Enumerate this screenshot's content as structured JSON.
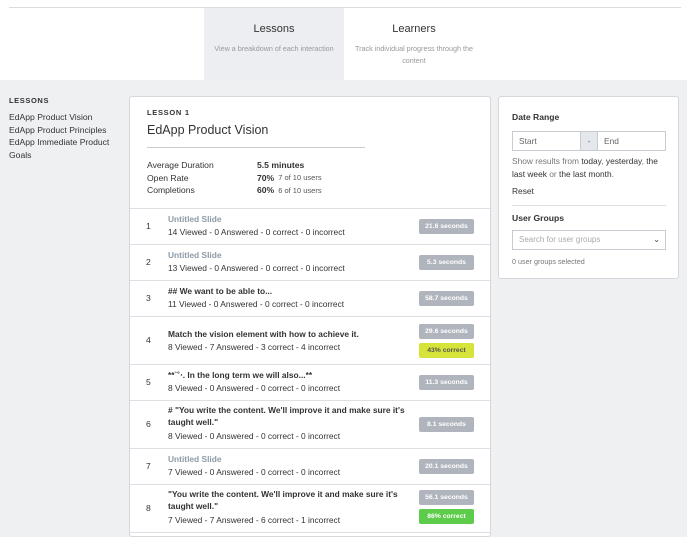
{
  "tabs": [
    {
      "title": "Lessons",
      "desc": "View a breakdown of each interaction"
    },
    {
      "title": "Learners",
      "desc": "Track individual progress through the content"
    }
  ],
  "sidebar": {
    "heading": "LESSONS",
    "items": [
      "EdApp Product Vision",
      "EdApp Product Principles",
      "EdApp Immediate Product Goals"
    ]
  },
  "lesson": {
    "label": "LESSON 1",
    "title": "EdApp Product Vision",
    "stats": [
      {
        "key": "Average Duration",
        "value": "5.5 minutes",
        "sub": ""
      },
      {
        "key": "Open Rate",
        "value": "70%",
        "sub": "7 of 10 users"
      },
      {
        "key": "Completions",
        "value": "60%",
        "sub": "6 of 10 users"
      }
    ]
  },
  "slides": [
    {
      "num": "1",
      "title": "Untitled Slide",
      "untitled": true,
      "info": "14 Viewed - 0 Answered - 0 correct - 0 incorrect",
      "time": "21.6 seconds",
      "correct": ""
    },
    {
      "num": "2",
      "title": "Untitled Slide",
      "untitled": true,
      "info": "13 Viewed - 0 Answered - 0 correct - 0 incorrect",
      "time": "5.3 seconds",
      "correct": ""
    },
    {
      "num": "3",
      "title": "## We want to be able to...",
      "untitled": false,
      "info": "11 Viewed - 0 Answered - 0 correct - 0 incorrect",
      "time": "58.7 seconds",
      "correct": ""
    },
    {
      "num": "4",
      "title": "Match the vision element with how to achieve it.",
      "untitled": false,
      "info": "8 Viewed - 7 Answered - 3 correct - 4 incorrect",
      "time": "29.6 seconds",
      "correct": "43% correct",
      "correctColor": "lime"
    },
    {
      "num": "5",
      "title": "**`˚‧. In the long term we will also...**",
      "untitled": false,
      "info": "8 Viewed - 0 Answered - 0 correct - 0 incorrect",
      "time": "11.3 seconds",
      "correct": ""
    },
    {
      "num": "6",
      "title": "# \"You write the content. We'll improve it and make sure it's taught well.\"",
      "untitled": false,
      "info": "8 Viewed - 0 Answered - 0 correct - 0 incorrect",
      "time": "8.1 seconds",
      "correct": ""
    },
    {
      "num": "7",
      "title": "Untitled Slide",
      "untitled": true,
      "info": "7 Viewed - 0 Answered - 0 correct - 0 incorrect",
      "time": "20.1 seconds",
      "correct": ""
    },
    {
      "num": "8",
      "title": "\"You write the content. We'll improve it and make sure it's taught well.\"",
      "untitled": false,
      "info": "7 Viewed - 7 Answered - 6 correct - 1 incorrect",
      "time": "56.1 seconds",
      "correct": "86% correct",
      "correctColor": "green"
    }
  ],
  "filters": {
    "date_title": "Date Range",
    "start_placeholder": "Start",
    "dash": "-",
    "end_placeholder": "End",
    "show_prefix": "Show results from ",
    "opt_today": "today",
    "comma": ", ",
    "opt_yesterday": "yesterday",
    "comma2": ", ",
    "opt_week": "the last week",
    "or": " or ",
    "opt_month": "the last month",
    "period": ".",
    "reset": "Reset",
    "groups_title": "User Groups",
    "groups_placeholder": "Search for user groups",
    "groups_count": "0 user groups selected"
  },
  "colors": {
    "accent_lime": "#d6e43a",
    "accent_green": "#5ccc4a",
    "badge_gray": "#b0b5bd"
  }
}
